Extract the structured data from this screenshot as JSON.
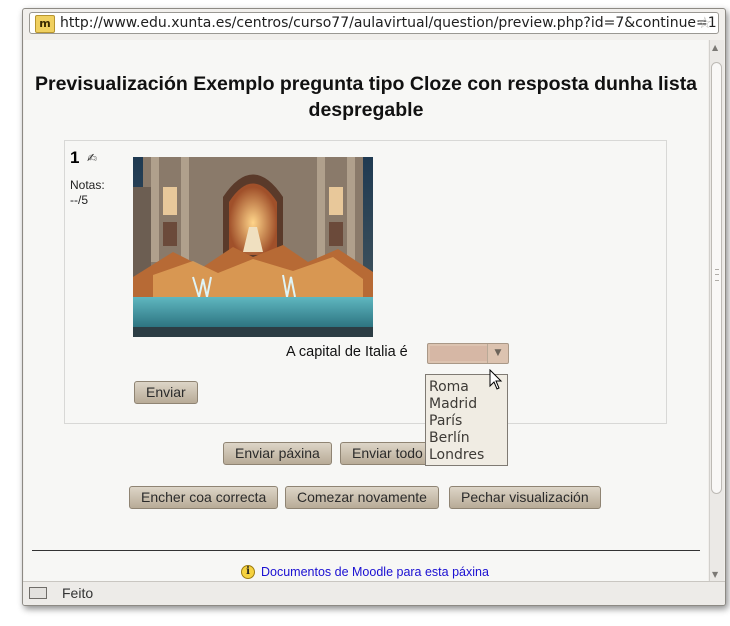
{
  "browser": {
    "url": "http://www.edu.xunta.es/centros/curso77/aulavirtual/question/preview.php?id=7&continue=1",
    "site_icon_text": "m",
    "status": "Feito"
  },
  "page": {
    "title": "Previsualización Exemplo pregunta tipo Cloze con resposta dunha lista despregable"
  },
  "question": {
    "number": "1",
    "grade_label": "Notas:",
    "grade_value": "--/5",
    "text": "A capital de Italia é",
    "submit_label": "Enviar",
    "select_options": [
      "Roma",
      "Madrid",
      "París",
      "Berlín",
      "Londres"
    ]
  },
  "actions": {
    "submit_page": "Enviar páxina",
    "submit_all": "Enviar todo",
    "fill_correct": "Encher coa correcta",
    "start_again": "Comezar novamente",
    "close_preview": "Pechar visualización"
  },
  "footer": {
    "docs_link": "Documentos de Moodle para esta páxina"
  },
  "icons": {
    "edit": "pencil-icon",
    "info": "info-icon",
    "star": "bookmark-star-icon",
    "cursor": "mouse-pointer-icon"
  }
}
